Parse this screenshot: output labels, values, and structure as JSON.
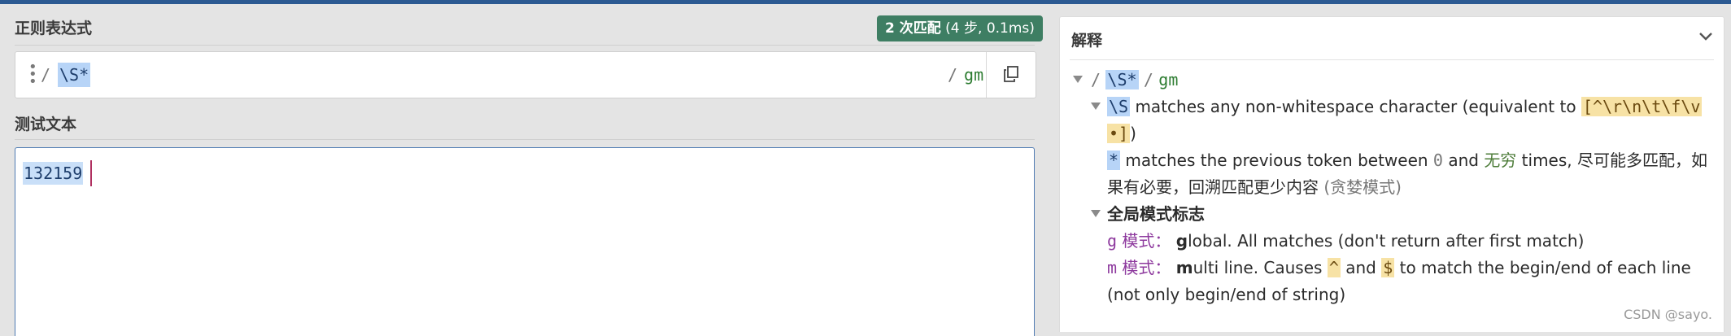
{
  "left": {
    "regex_label": "正则表达式",
    "test_label": "测试文本",
    "match_badge": {
      "count": "2 次匹配",
      "detail": "(4 步, 0.1ms)"
    },
    "regex": {
      "open": "/",
      "pattern": "\\S*",
      "close": "/",
      "flags": "gm"
    },
    "test_text": "132159"
  },
  "explanation": {
    "title": "解释",
    "root": {
      "open": "/",
      "pattern": "\\S*",
      "close": "/",
      "flags": "gm"
    },
    "token1": {
      "token": "\\S",
      "text_a": "matches any non-whitespace character (equivalent to ",
      "class_part1": "[^\\r\\n\\t\\f\\v",
      "class_part2": "•]",
      "text_b": ")"
    },
    "token2": {
      "token": "*",
      "text_a": "matches the previous token between ",
      "zero": "0",
      "and": " and ",
      "infinite": "无穷",
      "text_b": " times, 尽可能多匹配，如",
      "text_c": "果有必要，回溯匹配更少内容",
      "greedy": "(贪婪模式)"
    },
    "flags_heading": "全局模式标志",
    "flag_g": {
      "letter": "g",
      "mode": "模式：",
      "bold": "g",
      "rest": "lobal. All matches (don't return after first match)"
    },
    "flag_m": {
      "letter": "m",
      "mode": "模式：",
      "bold": "m",
      "rest": "ulti line. Causes ",
      "caret": "^",
      "and": " and ",
      "dollar": "$",
      "rest2": " to match the begin/end of each line",
      "line2": "(not only begin/end of string)"
    }
  },
  "watermark": "CSDN @sayo."
}
